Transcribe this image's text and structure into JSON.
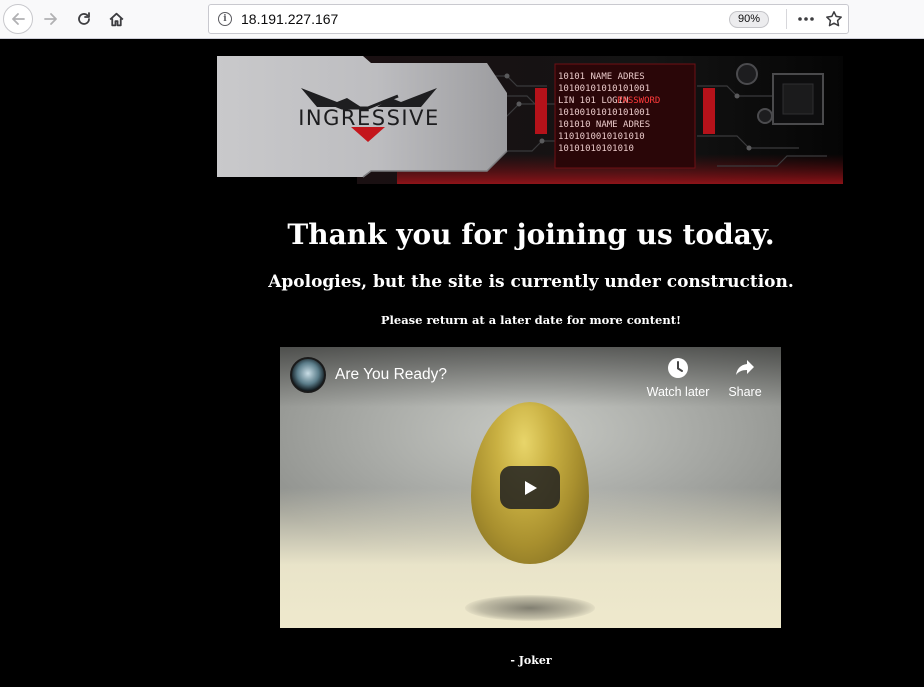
{
  "browser": {
    "url": "18.191.227.167",
    "zoom": "90%",
    "icons": {
      "back": "back-arrow-icon",
      "forward": "forward-arrow-icon",
      "reload": "reload-icon",
      "home": "home-icon",
      "info": "info-icon",
      "more": "more-dots-icon",
      "bookmark": "star-icon"
    }
  },
  "banner": {
    "brand": "INGRESSIVE",
    "code_lines": [
      "10101 NAME ADRES",
      "10100101010101001",
      "LIN 101 LOGIN",
      "PASSWORD",
      "10100101010101001",
      "101010 NAME ADRES",
      "1101010010101010",
      "10101010101010"
    ]
  },
  "page": {
    "headline": "Thank you for joining us today.",
    "subheadline": "Apologies, but the site is currently under construction.",
    "note": "Please return at a later date for more content!",
    "signature": "- Joker"
  },
  "video": {
    "title": "Are You Ready?",
    "watch_later_label": "Watch later",
    "share_label": "Share"
  },
  "colors": {
    "page_background": "#000000",
    "text": "#ffffff",
    "brand_red": "#c4161c"
  }
}
